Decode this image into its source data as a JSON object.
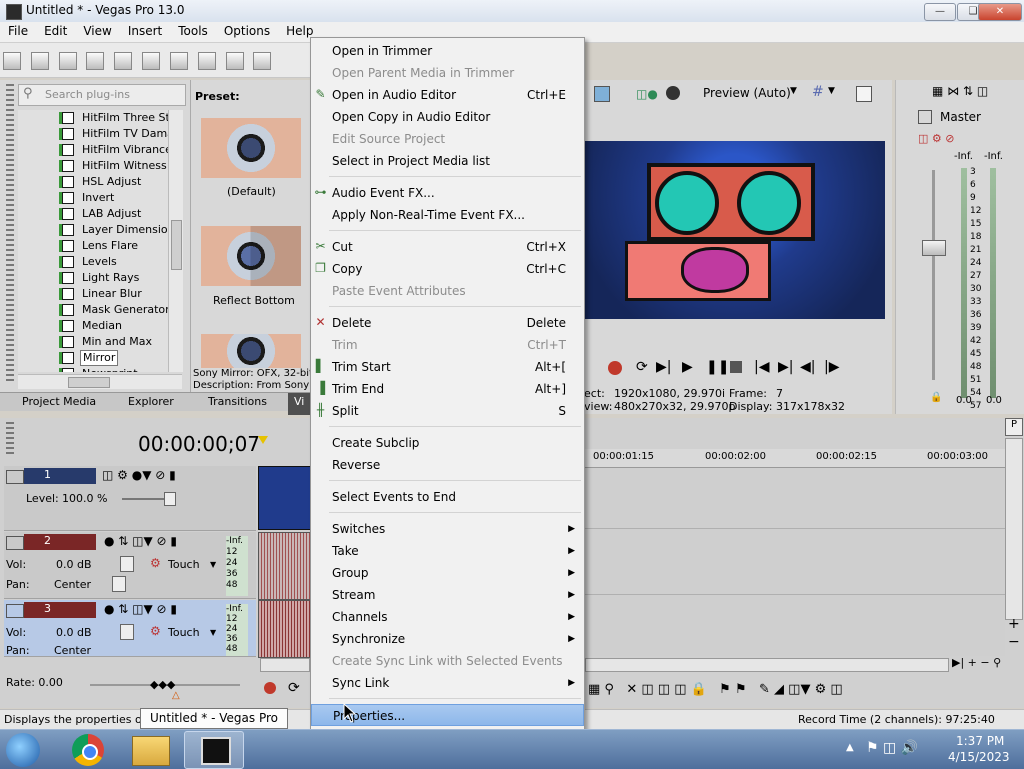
{
  "window": {
    "title": "Untitled * - Vegas Pro 13.0"
  },
  "menubar": [
    "File",
    "Edit",
    "View",
    "Insert",
    "Tools",
    "Options",
    "Help"
  ],
  "plugins": {
    "search_placeholder": "Search plug-ins",
    "items": [
      "HitFilm Three Strip",
      "HitFilm TV Damage",
      "HitFilm Vibrance",
      "HitFilm Witness Pr",
      "HSL Adjust",
      "Invert",
      "LAB Adjust",
      "Layer Dimensional",
      "Lens Flare",
      "Levels",
      "Light Rays",
      "Linear Blur",
      "Mask Generator",
      "Median",
      "Min and Max",
      "Mirror",
      "Newsprint"
    ],
    "selected": "Mirror"
  },
  "preset": {
    "header": "Preset:",
    "items": [
      "(Default)",
      "Reflect Bottom"
    ],
    "info_line1": "Sony Mirror: OFX, 32-bit",
    "info_line2": "Description: From Sony C"
  },
  "bottom_tabs": [
    "Project Media",
    "Explorer",
    "Transitions",
    "Vi"
  ],
  "context_menu": {
    "items": [
      {
        "label": "Open in Trimmer",
        "shortcut": "",
        "disabled": false,
        "icon": ""
      },
      {
        "label": "Open Parent Media in Trimmer",
        "shortcut": "",
        "disabled": true,
        "icon": ""
      },
      {
        "label": "Open in Audio Editor",
        "shortcut": "Ctrl+E",
        "disabled": false,
        "icon": "pen-icon"
      },
      {
        "label": "Open Copy in Audio Editor",
        "shortcut": "",
        "disabled": false,
        "icon": ""
      },
      {
        "label": "Edit Source Project",
        "shortcut": "",
        "disabled": true,
        "icon": ""
      },
      {
        "label": "Select in Project Media list",
        "shortcut": "",
        "disabled": false,
        "icon": ""
      },
      {
        "sep": true
      },
      {
        "label": "Audio Event FX...",
        "shortcut": "",
        "disabled": false,
        "icon": "fx-icon"
      },
      {
        "label": "Apply Non-Real-Time Event FX...",
        "shortcut": "",
        "disabled": false,
        "icon": ""
      },
      {
        "sep": true
      },
      {
        "label": "Cut",
        "shortcut": "Ctrl+X",
        "disabled": false,
        "icon": "scissors-icon"
      },
      {
        "label": "Copy",
        "shortcut": "Ctrl+C",
        "disabled": false,
        "icon": "copy-icon"
      },
      {
        "label": "Paste Event Attributes",
        "shortcut": "",
        "disabled": true,
        "icon": ""
      },
      {
        "sep": true
      },
      {
        "label": "Delete",
        "shortcut": "Delete",
        "disabled": false,
        "icon": "delete-icon"
      },
      {
        "label": "Trim",
        "shortcut": "Ctrl+T",
        "disabled": true,
        "icon": ""
      },
      {
        "label": "Trim Start",
        "shortcut": "Alt+[",
        "disabled": false,
        "icon": "trim-start-icon"
      },
      {
        "label": "Trim End",
        "shortcut": "Alt+]",
        "disabled": false,
        "icon": "trim-end-icon"
      },
      {
        "label": "Split",
        "shortcut": "S",
        "disabled": false,
        "icon": "split-icon"
      },
      {
        "sep": true
      },
      {
        "label": "Create Subclip",
        "shortcut": "",
        "disabled": false,
        "icon": ""
      },
      {
        "label": "Reverse",
        "shortcut": "",
        "disabled": false,
        "icon": ""
      },
      {
        "sep": true
      },
      {
        "label": "Select Events to End",
        "shortcut": "",
        "disabled": false,
        "icon": ""
      },
      {
        "sep": true
      },
      {
        "label": "Switches",
        "shortcut": "",
        "disabled": false,
        "icon": "",
        "submenu": true
      },
      {
        "label": "Take",
        "shortcut": "",
        "disabled": false,
        "icon": "",
        "submenu": true
      },
      {
        "label": "Group",
        "shortcut": "",
        "disabled": false,
        "icon": "",
        "submenu": true
      },
      {
        "label": "Stream",
        "shortcut": "",
        "disabled": false,
        "icon": "",
        "submenu": true
      },
      {
        "label": "Channels",
        "shortcut": "",
        "disabled": false,
        "icon": "",
        "submenu": true
      },
      {
        "label": "Synchronize",
        "shortcut": "",
        "disabled": false,
        "icon": "",
        "submenu": true
      },
      {
        "label": "Create Sync Link with Selected Events",
        "shortcut": "",
        "disabled": true,
        "icon": ""
      },
      {
        "label": "Sync Link",
        "shortcut": "",
        "disabled": false,
        "icon": "",
        "submenu": true
      },
      {
        "sep": true
      },
      {
        "label": "Properties...",
        "shortcut": "",
        "disabled": false,
        "icon": "",
        "selected": true
      }
    ]
  },
  "preview": {
    "mode": "Preview (Auto)",
    "project_label": "ect:",
    "project_value": "1920x1080, 29.970i",
    "preview_label": "view:",
    "preview_value": "480x270x32, 29.970p",
    "frame_label": "Frame:",
    "frame_value": "7",
    "display_label": "Display:",
    "display_value": "317x178x32"
  },
  "mixer": {
    "title": "Master",
    "inf_left": "-Inf.",
    "inf_right": "-Inf.",
    "scale": [
      "3",
      "6",
      "9",
      "12",
      "15",
      "18",
      "21",
      "24",
      "27",
      "30",
      "33",
      "36",
      "39",
      "42",
      "45",
      "48",
      "51",
      "54",
      "57"
    ],
    "readout_left": "0.0",
    "readout_right": "0.0"
  },
  "timeline": {
    "timecode": "00:00:00;07",
    "ruler": [
      "00:00:01:15",
      "00:00:02:00",
      "00:00:02:15",
      "00:00:03:00"
    ],
    "tracks": [
      {
        "num": "1",
        "type": "video",
        "level_label": "Level:",
        "level_value": "100.0 %"
      },
      {
        "num": "2",
        "type": "audio",
        "vol_label": "Vol:",
        "vol_value": "0.0 dB",
        "pan_label": "Pan:",
        "pan_value": "Center",
        "mode": "Touch",
        "meter": [
          "-Inf.",
          "12",
          "24",
          "36",
          "48"
        ]
      },
      {
        "num": "3",
        "type": "audio",
        "vol_label": "Vol:",
        "vol_value": "0.0 dB",
        "pan_label": "Pan:",
        "pan_value": "Center",
        "mode": "Touch",
        "meter": [
          "-Inf.",
          "12",
          "24",
          "36",
          "48"
        ]
      }
    ],
    "rate": "Rate: 0.00"
  },
  "status": {
    "left": "Displays the properties of th",
    "right": "Record Time (2 channels): 97:25:40"
  },
  "tooltip": "Untitled * - Vegas Pro 13.0",
  "taskbar": {
    "time": "1:37 PM",
    "date": "4/15/2023"
  },
  "colors": {
    "menu_highlight": "#8db7ea",
    "accent_red": "#c0392b",
    "video_bg": "#1e2e66"
  }
}
